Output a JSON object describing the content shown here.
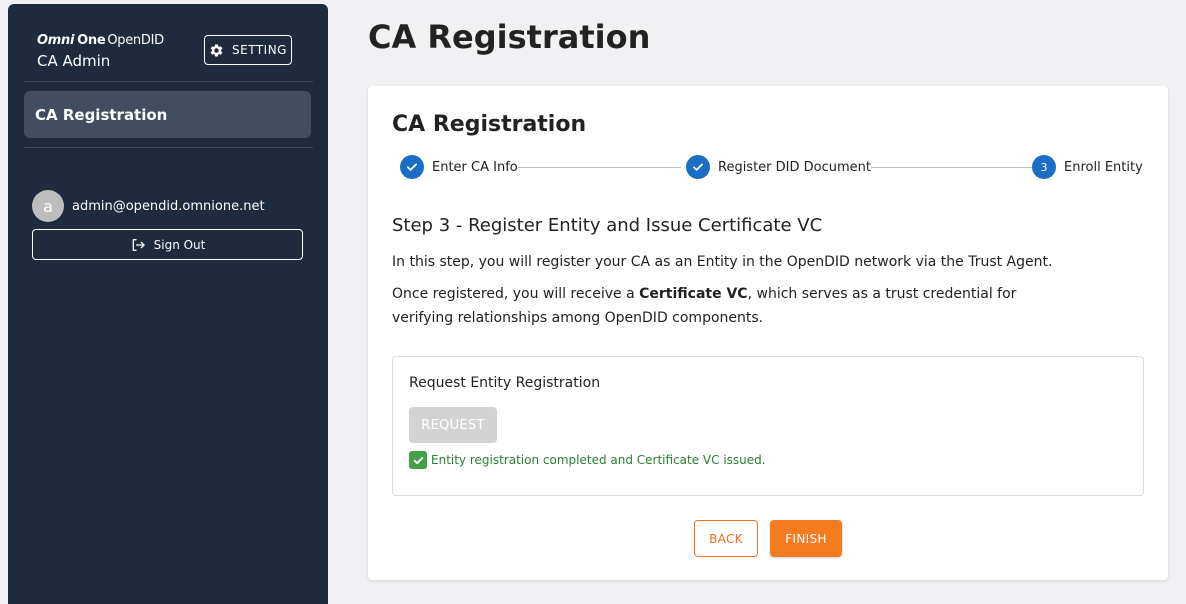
{
  "sidebar": {
    "logo_omni": "Omni",
    "logo_one": "One",
    "logo_opendid": "OpenDID",
    "subtitle": "CA Admin",
    "setting_label": "SETTING",
    "nav_items": [
      {
        "label": "CA Registration",
        "active": true
      }
    ],
    "user": {
      "avatar_letter": "a",
      "email": "admin@opendid.omnione.net"
    },
    "signout_label": "Sign Out"
  },
  "page": {
    "title": "CA Registration"
  },
  "card": {
    "title": "CA Registration",
    "steps": [
      {
        "label": "Enter CA Info",
        "state": "done"
      },
      {
        "label": "Register DID Document",
        "state": "done"
      },
      {
        "label": "Enroll Entity",
        "state": "active",
        "number": "3"
      }
    ],
    "step_heading": "Step 3 - Register Entity and Issue Certificate VC",
    "para1": "In this step, you will register your CA as an Entity in the OpenDID network via the Trust Agent.",
    "para2_before": "Once registered, you will receive a ",
    "para2_bold": "Certificate VC",
    "para2_after": ", which serves as a trust credential for verifying relationships among OpenDID components.",
    "box_title": "Request Entity Registration",
    "request_label": "REQUEST",
    "status_text": "Entity registration completed and Certificate VC issued.",
    "back_label": "BACK",
    "finish_label": "FINISH"
  },
  "colors": {
    "sidebar_bg": "#1e2a3e",
    "accent_blue": "#1a6fc4",
    "accent_orange": "#f47b20",
    "success_green": "#2e7d32"
  },
  "icons": {
    "setting": "gear-icon",
    "signout": "logout-icon",
    "step_done": "check-icon",
    "status": "check-box-icon"
  }
}
